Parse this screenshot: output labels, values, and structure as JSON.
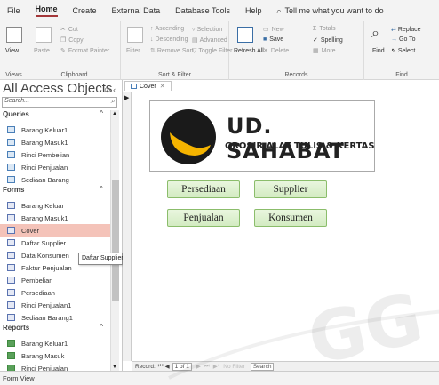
{
  "menu": {
    "items": [
      "File",
      "Home",
      "Create",
      "External Data",
      "Database Tools",
      "Help"
    ],
    "active": "Home",
    "tell_me": "Tell me what you want to do"
  },
  "ribbon": {
    "views": {
      "label": "Views",
      "view": "View"
    },
    "clipboard": {
      "label": "Clipboard",
      "paste": "Paste",
      "cut": "Cut",
      "copy": "Copy",
      "format_painter": "Format Painter"
    },
    "sort_filter": {
      "label": "Sort & Filter",
      "filter": "Filter",
      "ascending": "Ascending",
      "descending": "Descending",
      "remove_sort": "Remove Sort",
      "selection": "Selection",
      "advanced": "Advanced",
      "toggle_filter": "Toggle Filter"
    },
    "records": {
      "label": "Records",
      "refresh_all": "Refresh All",
      "new": "New",
      "save": "Save",
      "delete": "Delete",
      "totals": "Totals",
      "spelling": "Spelling",
      "more": "More"
    },
    "find": {
      "label": "Find",
      "find": "Find",
      "replace": "Replace",
      "go_to": "Go To",
      "select": "Select"
    }
  },
  "nav": {
    "title": "All Access Objects",
    "search_placeholder": "Search...",
    "sections": [
      {
        "name": "Queries",
        "type": "query",
        "items": [
          "Barang Keluar1",
          "Barang Masuk1",
          "Rinci Pembelian",
          "Rinci Penjualan",
          "Sediaan Barang"
        ]
      },
      {
        "name": "Forms",
        "type": "form",
        "items": [
          "Barang Keluar",
          "Barang Masuk1",
          "Cover",
          "Daftar Supplier",
          "Data Konsumen",
          "Faktur Penjualan",
          "Pembelian",
          "Persediaan",
          "Rinci Penjualan1",
          "Sediaan Barang1"
        ]
      },
      {
        "name": "Reports",
        "type": "report",
        "items": [
          "Barang Keluar1",
          "Barang Masuk",
          "Rinci Penjualan"
        ]
      }
    ],
    "selected": "Cover",
    "tooltip": "Daftar Supplier"
  },
  "document": {
    "tab": "Cover",
    "logo_main": "UD. SAHABAT",
    "logo_sub": "GROSIR ALAT TULIS & KERTAS",
    "buttons": {
      "persediaan": "Persediaan",
      "supplier": "Supplier",
      "penjualan": "Penjualan",
      "konsumen": "Konsumen"
    },
    "record_nav": {
      "label": "Record:",
      "position": "1 of 1",
      "no_filter": "No Filter",
      "search": "Search"
    }
  },
  "status": {
    "text": "Form View"
  },
  "watermark": "GG",
  "colors": {
    "accent": "#a4373a",
    "selected_item": "#f4c3b9",
    "button_fill": "#d3ebc2",
    "logo_yellow": "#f5b400"
  }
}
